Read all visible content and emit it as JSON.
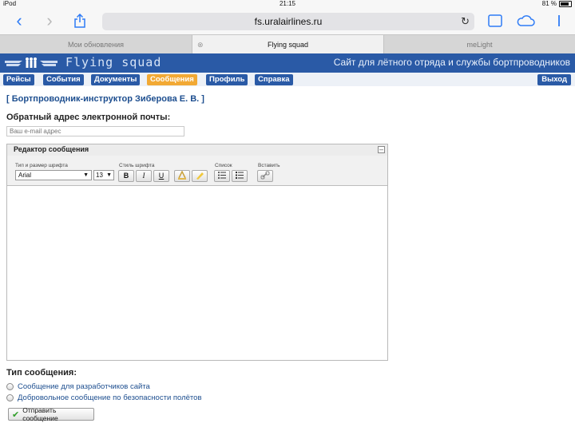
{
  "status_bar": {
    "device": "iPod",
    "time": "21:15",
    "battery": "81 %"
  },
  "browser": {
    "url": "fs.uralairlines.ru",
    "tabs": [
      {
        "label": "Мои обновления",
        "active": false
      },
      {
        "label": "Flying squad",
        "active": true
      },
      {
        "label": "meLight",
        "active": false
      }
    ]
  },
  "site": {
    "title": "Flying squad",
    "tagline": "Сайт для лётного отряда и службы бортпроводников",
    "menu": [
      "Рейсы",
      "События",
      "Документы",
      "Сообщения",
      "Профиль",
      "Справка"
    ],
    "active_menu": "Сообщения",
    "logout": "Выход",
    "colors": {
      "header": "#2a5aa6",
      "active_menu": "#f2a934"
    }
  },
  "form": {
    "recipient": "[ Бортпроводник-инструктор Зиберова Е. В. ]",
    "email_label": "Обратный адрес электронной почты:",
    "email_placeholder": "Ваш e-mail адрес",
    "editor": {
      "title": "Редактор сообщения",
      "font_group_label": "Тип и размер шрифта",
      "font_value": "Arial",
      "size_value": "13",
      "style_group_label": "Стиль шрифта",
      "bold": "B",
      "italic": "I",
      "underline": "U",
      "list_group_label": "Список",
      "insert_group_label": "Вставить"
    },
    "type_label": "Тип сообщения:",
    "types": [
      "Сообщение для разработчиков сайта",
      "Добровольное сообщение по безопасности полётов"
    ],
    "send_label": "Отправить сообщение"
  }
}
